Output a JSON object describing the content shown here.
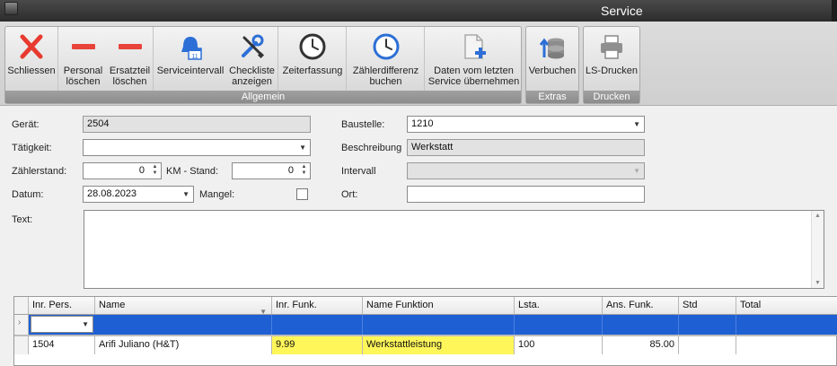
{
  "window": {
    "title": "Service"
  },
  "ribbon": {
    "groups": [
      {
        "label": "Allgemein"
      },
      {
        "label": "Extras"
      },
      {
        "label": "Drucken"
      }
    ],
    "buttons": {
      "schliessen": "Schliessen",
      "personal_loeschen": "Personal\nlöschen",
      "ersatzteil_loeschen": "Ersatzteil\nlöschen",
      "serviceintervall": "Serviceintervall",
      "checkliste": "Checkliste\nanzeigen",
      "zeiterfassung": "Zeiterfassung",
      "zaehlerdifferenz": "Zählerdifferenz\nbuchen",
      "daten_uebernehmen": "Daten vom letzten\nService übernehmen",
      "verbuchen": "Verbuchen",
      "ls_drucken": "LS-Drucken"
    },
    "icons": {
      "schliessen": "close-x-icon",
      "personal_loeschen": "minus-icon",
      "ersatzteil_loeschen": "minus-icon",
      "serviceintervall": "calendar-alarm-icon",
      "checkliste": "wrench-screwdriver-icon",
      "zeiterfassung": "clock-icon",
      "zaehlerdifferenz": "clock-icon",
      "daten_uebernehmen": "document-add-icon",
      "verbuchen": "database-upload-icon",
      "ls_drucken": "printer-icon"
    }
  },
  "form": {
    "geraet": {
      "label": "Gerät:",
      "value": "2504"
    },
    "taetigkeit": {
      "label": "Tätigkeit:",
      "value": ""
    },
    "zaehlerstand": {
      "label": "Zählerstand:",
      "value": "0"
    },
    "km_stand": {
      "label": "KM - Stand:",
      "value": "0"
    },
    "datum": {
      "label": "Datum:",
      "value": "28.08.2023"
    },
    "mangel": {
      "label": "Mangel:",
      "checked": false
    },
    "text": {
      "label": "Text:",
      "value": ""
    },
    "baustelle": {
      "label": "Baustelle:",
      "value": "1210"
    },
    "beschreibung": {
      "label": "Beschreibung",
      "value": "Werkstatt"
    },
    "intervall": {
      "label": "Intervall",
      "value": ""
    },
    "ort": {
      "label": "Ort:",
      "value": ""
    }
  },
  "grid": {
    "columns": [
      "Inr. Pers.",
      "Name",
      "Inr. Funk.",
      "Name Funktion",
      "Lsta.",
      "Ans. Funk.",
      "Std",
      "Total"
    ],
    "new_row": {
      "inr_pers": ""
    },
    "rows": [
      {
        "inr_pers": "1504",
        "name": "Arifi Juliano (H&T)",
        "inr_funk": "9.99",
        "name_funktion": "Werkstattleistung",
        "lsta": "100",
        "ans_funk": "85.00",
        "std": "",
        "total": ""
      }
    ],
    "highlight_color": "#fff65a",
    "selection_color": "#1e5fd3"
  },
  "colors": {
    "close_red": "#e83a2f",
    "minus_red": "#e8443a",
    "accent_blue": "#2d6fd6"
  }
}
